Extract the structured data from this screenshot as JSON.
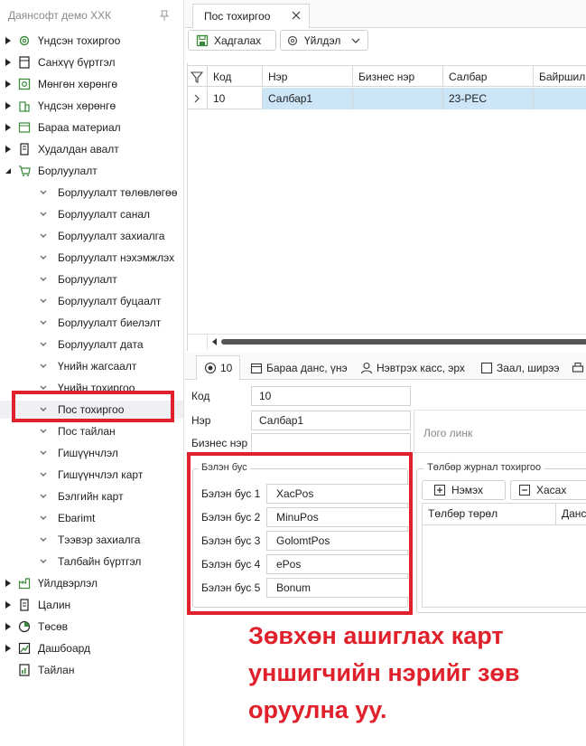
{
  "sidebar": {
    "company": "Даянсофт демо ХХК",
    "items": [
      {
        "label": "Үндсэн тохиргоо",
        "icon": "gear-icon"
      },
      {
        "label": "Санхүү бүртгэл",
        "icon": "ledger-icon"
      },
      {
        "label": "Мөнгөн хөрөнгө",
        "icon": "safe-icon"
      },
      {
        "label": "Үндсэн хөрөнгө",
        "icon": "building-icon"
      },
      {
        "label": "Бараа материал",
        "icon": "box-icon"
      },
      {
        "label": "Худалдан авалт",
        "icon": "register-icon"
      },
      {
        "label": "Борлуулалт",
        "icon": "cart-icon"
      }
    ],
    "sales_children": [
      "Борлуулалт төлөвлөгөө",
      "Борлуулалт санал",
      "Борлуулалт захиалга",
      "Борлуулалт нэхэмжлэх",
      "Борлуулалт",
      "Борлуулалт буцаалт",
      "Борлуулалт биелэлт",
      "Борлуулалт дата",
      "Үнийн жагсаалт",
      "Үнийн тохиргоо",
      "Пос тохиргоо",
      "Пос тайлан",
      "Гишүүнчлэл",
      "Гишүүнчлэл карт",
      "Бэлгийн карт",
      "Ebarimt",
      "Тээвэр захиалга",
      "Талбайн бүртгэл"
    ],
    "bottom_items": [
      {
        "label": "Үйлдвэрлэл",
        "icon": "factory-icon"
      },
      {
        "label": "Цалин",
        "icon": "payroll-icon"
      },
      {
        "label": "Төсөв",
        "icon": "pie-icon"
      },
      {
        "label": "Дашбоард",
        "icon": "chart-icon"
      },
      {
        "label": "Тайлан",
        "icon": "report-icon"
      }
    ]
  },
  "tab": {
    "title": "Пос тохиргоо"
  },
  "toolbar": {
    "save": "Хадгалах",
    "actions": "Үйлдэл"
  },
  "grid": {
    "columns": [
      "Код",
      "Нэр",
      "Бизнес нэр",
      "Салбар",
      "Байршил"
    ],
    "rows": [
      {
        "code": "10",
        "name": "Салбар1",
        "business": "",
        "branch": "23-PEC",
        "location": ""
      }
    ]
  },
  "detail_tabs": [
    "10",
    "Бараа данс, үнэ",
    "Нэвтрэх касс, эрх",
    "Заал, ширээ"
  ],
  "form": {
    "code_label": "Код",
    "code": "10",
    "name_label": "Нэр",
    "name": "Салбар1",
    "business_label": "Бизнес нэр",
    "business": "",
    "logo_link": "Лого линк"
  },
  "non_cash": {
    "title": "Бэлэн бус",
    "items": [
      {
        "label": "Бэлэн бус 1",
        "value": "XacPos"
      },
      {
        "label": "Бэлэн бус 2",
        "value": "MinuPos"
      },
      {
        "label": "Бэлэн бус 3",
        "value": "GolomtPos"
      },
      {
        "label": "Бэлэн бус 4",
        "value": "ePos"
      },
      {
        "label": "Бэлэн бус 5",
        "value": "Bonum"
      }
    ]
  },
  "payment_journal": {
    "title": "Төлбөр журнал тохиргоо",
    "add": "Нэмэх",
    "remove": "Хасах",
    "columns": [
      "Төлбөр төрөл",
      "Данс"
    ]
  },
  "annotation": "Зөвхөн ашиглах карт уншигчийн нэрийг зөв оруулна уу.",
  "colors": {
    "accent": "#e0212b",
    "selected_row": "#cde6f7",
    "icon_green": "#3a8a3a"
  }
}
